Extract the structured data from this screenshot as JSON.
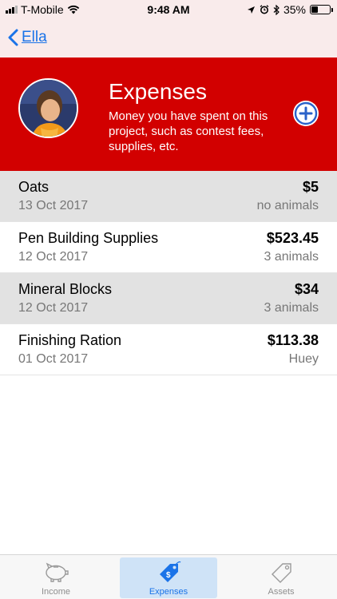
{
  "status_bar": {
    "carrier": "T-Mobile",
    "time": "9:48 AM",
    "battery": "35%",
    "battery_level": 0.35
  },
  "nav": {
    "back_label": "Ella"
  },
  "header": {
    "title": "Expenses",
    "description": "Money you have spent on this project, such as contest fees, supplies, etc."
  },
  "expenses": [
    {
      "name": "Oats",
      "date": "13 Oct 2017",
      "amount": "$5",
      "detail": "no animals"
    },
    {
      "name": "Pen Building Supplies",
      "date": "12 Oct 2017",
      "amount": "$523.45",
      "detail": "3 animals"
    },
    {
      "name": "Mineral Blocks",
      "date": "12 Oct 2017",
      "amount": "$34",
      "detail": "3 animals"
    },
    {
      "name": "Finishing Ration",
      "date": "01 Oct 2017",
      "amount": "$113.38",
      "detail": "Huey"
    }
  ],
  "tabs": [
    {
      "label": "Income",
      "icon": "piggy-bank-icon"
    },
    {
      "label": "Expenses",
      "icon": "price-tag-dollar-icon"
    },
    {
      "label": "Assets",
      "icon": "tag-icon"
    }
  ],
  "colors": {
    "header_red": "#d20000",
    "accent_blue": "#1a73e8",
    "bar_pink": "#f9ebeb",
    "shaded_row": "#e2e2e2"
  }
}
